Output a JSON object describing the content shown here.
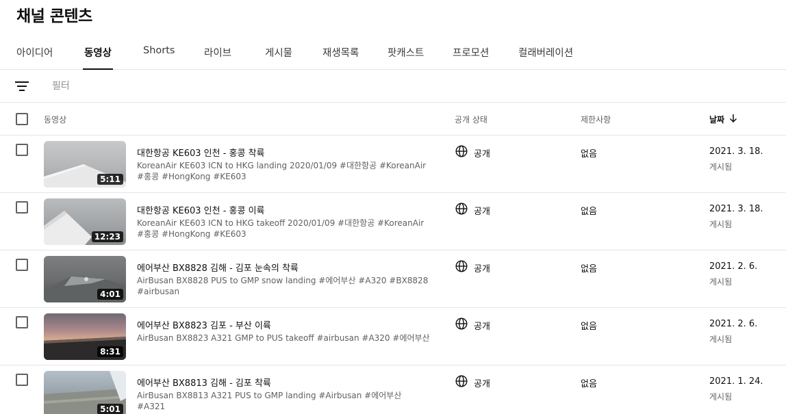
{
  "page": {
    "title": "채널 콘텐츠"
  },
  "tabs": [
    {
      "label": "아이디어",
      "active": false
    },
    {
      "label": "동영상",
      "active": true
    },
    {
      "label": "Shorts",
      "active": false
    },
    {
      "label": "라이브",
      "active": false
    },
    {
      "label": "게시물",
      "active": false
    },
    {
      "label": "재생목록",
      "active": false
    },
    {
      "label": "팟캐스트",
      "active": false
    },
    {
      "label": "프로모션",
      "active": false
    },
    {
      "label": "컬래버레이션",
      "active": false
    }
  ],
  "filter": {
    "placeholder": "필터",
    "icon": "filter-icon"
  },
  "table": {
    "headers": {
      "video": "동영상",
      "visibility": "공개 상태",
      "restrictions": "제한사항",
      "date": "날짜"
    },
    "sort_icon": "arrow-down-icon",
    "rows": [
      {
        "duration": "5:11",
        "title": "대한항공 KE603 인천 - 홍콩 착륙",
        "description": "KoreanAir KE603 ICN to HKG landing 2020/01/09 #대한항공 #KoreanAir #홍콩 #HongKong #KE603",
        "visibility": "공개",
        "restrictions": "없음",
        "date": "2021. 3. 18.",
        "date_status": "게시됨"
      },
      {
        "duration": "12:23",
        "title": "대한항공 KE603 인천 - 홍콩 이륙",
        "description": "KoreanAir KE603 ICN to HKG takeoff 2020/01/09 #대한항공 #KoreanAir #홍콩 #HongKong #KE603",
        "visibility": "공개",
        "restrictions": "없음",
        "date": "2021. 3. 18.",
        "date_status": "게시됨"
      },
      {
        "duration": "4:01",
        "title": "에어부산 BX8828 김해 - 김포 눈속의 착륙",
        "description": "AirBusan BX8828 PUS to GMP snow landing #에어부산 #A320 #BX8828 #airbusan",
        "visibility": "공개",
        "restrictions": "없음",
        "date": "2021. 2. 6.",
        "date_status": "게시됨"
      },
      {
        "duration": "8:31",
        "title": "에어부산 BX8823 김포 - 부산 이륙",
        "description": "AirBusan BX8823 A321 GMP to PUS takeoff #airbusan #A320 #에어부산",
        "visibility": "공개",
        "restrictions": "없음",
        "date": "2021. 2. 6.",
        "date_status": "게시됨"
      },
      {
        "duration": "5:01",
        "title": "에어부산 BX8813 김해 - 김포 착륙",
        "description": "AirBusan BX8813 A321 PUS to GMP landing #Airbusan #에어부산 #A321",
        "visibility": "공개",
        "restrictions": "없음",
        "date": "2021. 1. 24.",
        "date_status": "게시됨"
      }
    ]
  }
}
